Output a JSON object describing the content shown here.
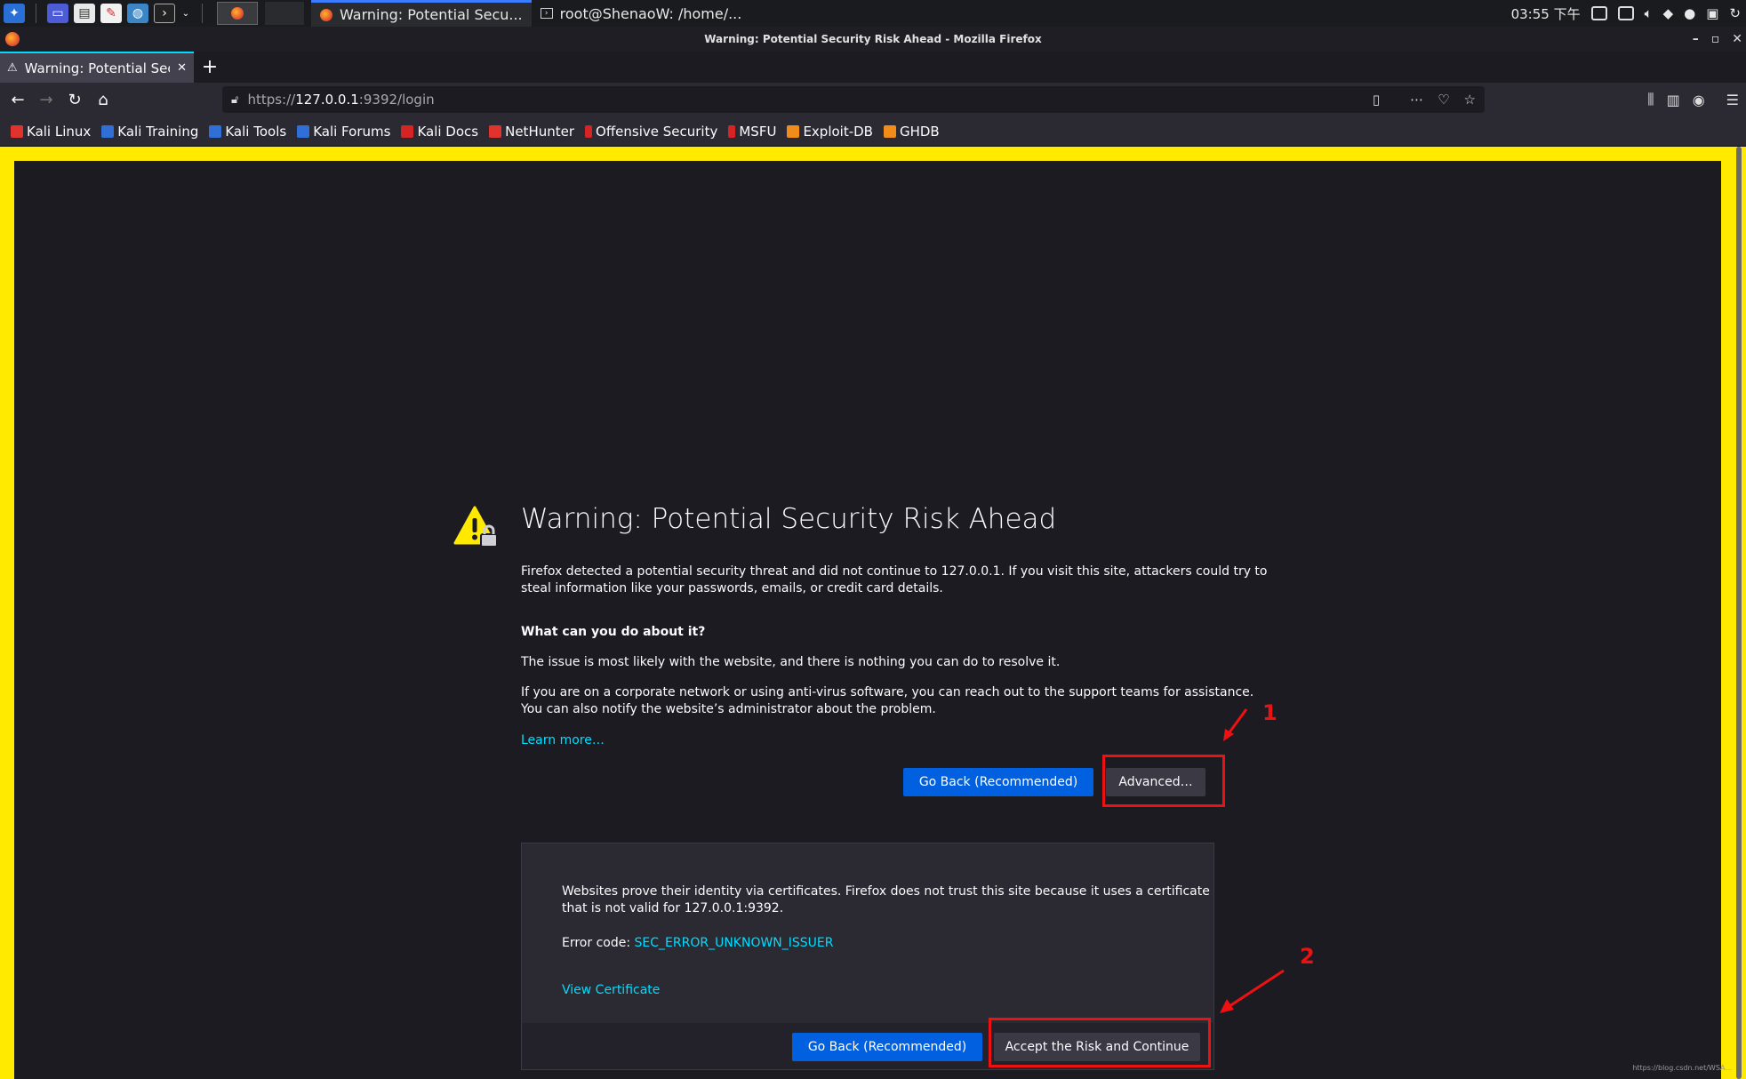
{
  "taskbar": {
    "tasks": [
      {
        "label": "Warning: Potential Secu...",
        "icon": "firefox-icon"
      },
      {
        "label": "root@ShenaoW: /home/...",
        "icon": "terminal-icon"
      }
    ],
    "time": "03:55 下午"
  },
  "window": {
    "title": "Warning: Potential Security Risk Ahead - Mozilla Firefox"
  },
  "tab": {
    "title": "Warning: Potential Secur",
    "close": "✕",
    "new": "+"
  },
  "urlbar": {
    "scheme": "https://",
    "host": "127.0.0.1",
    "path": ":9392/login"
  },
  "bookmarks": [
    {
      "label": "Kali Linux",
      "color": "#e0332e"
    },
    {
      "label": "Kali Training",
      "color": "#2f6fd6"
    },
    {
      "label": "Kali Tools",
      "color": "#2f6fd6"
    },
    {
      "label": "Kali Forums",
      "color": "#2f6fd6"
    },
    {
      "label": "Kali Docs",
      "color": "#d42424"
    },
    {
      "label": "NetHunter",
      "color": "#e0332e"
    },
    {
      "label": "Offensive Security",
      "color": "#d42424"
    },
    {
      "label": "MSFU",
      "color": "#d42424"
    },
    {
      "label": "Exploit-DB",
      "color": "#f08c1a"
    },
    {
      "label": "GHDB",
      "color": "#f08c1a"
    }
  ],
  "main": {
    "title": "Warning: Potential Security Risk Ahead",
    "intro1": "Firefox detected a potential security threat and did not continue to 127.0.0.1. If you visit this site, attackers could try to",
    "intro2": "steal information like your passwords, emails, or credit card details.",
    "question": "What can you do about it?",
    "p1": "The issue is most likely with the website, and there is nothing you can do to resolve it.",
    "p2a": "If you are on a corporate network or using anti-virus software, you can reach out to the support teams for assistance.",
    "p2b": "You can also notify the website’s administrator about the problem.",
    "learn_more": "Learn more…",
    "go_back": "Go Back (Recommended)",
    "advanced": "Advanced…"
  },
  "advanced": {
    "line1": "Websites prove their identity via certificates. Firefox does not trust this site because it uses a certificate",
    "line2": "that is not valid for 127.0.0.1:9392.",
    "error_label": "Error code: ",
    "error_code": "SEC_ERROR_UNKNOWN_ISSUER",
    "view_cert": "View Certificate",
    "go_back": "Go Back (Recommended)",
    "accept": "Accept the Risk and Continue"
  },
  "annotations": {
    "n1": "1",
    "n2": "2"
  },
  "watermark": "https://blog.csdn.net/WSA...",
  "colors": {
    "accent_blue": "#0060df",
    "link": "#00ddff",
    "frame_yellow": "#ffea00",
    "annotation_red": "#e11111"
  }
}
